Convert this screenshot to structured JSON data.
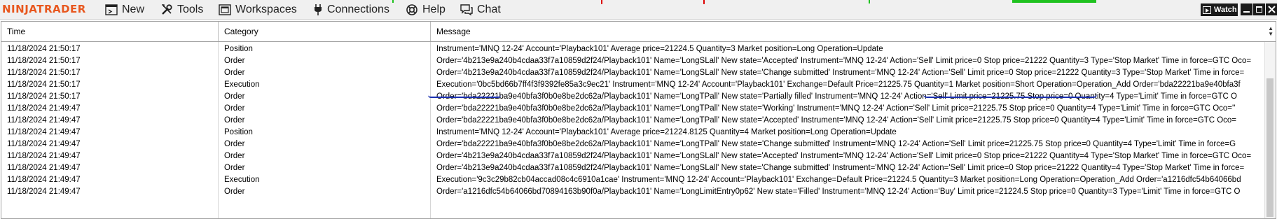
{
  "app": {
    "logo": "NINJATRADER"
  },
  "menu": {
    "items": [
      {
        "label": "New",
        "icon": "new-window-icon"
      },
      {
        "label": "Tools",
        "icon": "tools-icon"
      },
      {
        "label": "Workspaces",
        "icon": "workspaces-icon"
      },
      {
        "label": "Connections",
        "icon": "plug-icon"
      },
      {
        "label": "Help",
        "icon": "lifebuoy-icon"
      },
      {
        "label": "Chat",
        "icon": "chat-icon"
      }
    ],
    "watch_label": "Watch"
  },
  "grid": {
    "columns": [
      "Time",
      "Category",
      "Message"
    ],
    "rows": [
      {
        "time": "11/18/2024 21:50:17",
        "category": "Position",
        "message": "Instrument='MNQ 12-24' Account='Playback101' Average price=21224.5 Quantity=3 Market position=Long Operation=Update"
      },
      {
        "time": "11/18/2024 21:50:17",
        "category": "Order",
        "message": "Order='4b213e9a240b4cdaa33f7a10859d2f24/Playback101' Name='LongSLall' New state='Accepted' Instrument='MNQ 12-24' Action='Sell' Limit price=0 Stop price=21222 Quantity=3 Type='Stop Market' Time in force=GTC Oco="
      },
      {
        "time": "11/18/2024 21:50:17",
        "category": "Order",
        "message": "Order='4b213e9a240b4cdaa33f7a10859d2f24/Playback101' Name='LongSLall' New state='Change submitted' Instrument='MNQ 12-24' Action='Sell' Limit price=0 Stop price=21222 Quantity=3 Type='Stop Market' Time in force="
      },
      {
        "time": "11/18/2024 21:50:17",
        "category": "Execution",
        "message": "Execution='0bc5bd66b7ff4f3f9392fe85a3c9ec21' Instrument='MNQ 12-24' Account='Playback101' Exchange=Default Price=21225.75 Quantity=1 Market position=Short Operation=Operation_Add Order='bda22221ba9e40bfa3f"
      },
      {
        "time": "11/18/2024 21:50:17",
        "category": "Order",
        "message": "Order='bda22221ba9e40bfa3f0b0e8be2dc62a/Playback101' Name='LongTPall' New state='Partially filled' Instrument='MNQ 12-24' Action='Sell' Limit price=21225.75 Stop price=0 Quantity=4 Type='Limit' Time in force=GTC O"
      },
      {
        "time": "11/18/2024 21:49:47",
        "category": "Order",
        "message": "Order='bda22221ba9e40bfa3f0b0e8be2dc62a/Playback101' Name='LongTPall' New state='Working' Instrument='MNQ 12-24' Action='Sell' Limit price=21225.75 Stop price=0 Quantity=4 Type='Limit' Time in force=GTC Oco=''"
      },
      {
        "time": "11/18/2024 21:49:47",
        "category": "Order",
        "message": "Order='bda22221ba9e40bfa3f0b0e8be2dc62a/Playback101' Name='LongTPall' New state='Accepted' Instrument='MNQ 12-24' Action='Sell' Limit price=21225.75 Stop price=0 Quantity=4 Type='Limit' Time in force=GTC Oco="
      },
      {
        "time": "11/18/2024 21:49:47",
        "category": "Position",
        "message": "Instrument='MNQ 12-24' Account='Playback101' Average price=21224.8125 Quantity=4 Market position=Long Operation=Update"
      },
      {
        "time": "11/18/2024 21:49:47",
        "category": "Order",
        "message": "Order='bda22221ba9e40bfa3f0b0e8be2dc62a/Playback101' Name='LongTPall' New state='Change submitted' Instrument='MNQ 12-24' Action='Sell' Limit price=21225.75 Stop price=0 Quantity=4 Type='Limit' Time in force=G"
      },
      {
        "time": "11/18/2024 21:49:47",
        "category": "Order",
        "message": "Order='4b213e9a240b4cdaa33f7a10859d2f24/Playback101' Name='LongSLall' New state='Accepted' Instrument='MNQ 12-24' Action='Sell' Limit price=0 Stop price=21222 Quantity=4 Type='Stop Market' Time in force=GTC Oco="
      },
      {
        "time": "11/18/2024 21:49:47",
        "category": "Order",
        "message": "Order='4b213e9a240b4cdaa33f7a10859d2f24/Playback101' Name='LongSLall' New state='Change submitted' Instrument='MNQ 12-24' Action='Sell' Limit price=0 Stop price=21222 Quantity=4 Type='Stop Market' Time in force="
      },
      {
        "time": "11/18/2024 21:49:47",
        "category": "Execution",
        "message": "Execution='9c3c29b82cb04accad08c4c6910a1cae' Instrument='MNQ 12-24' Account='Playback101' Exchange=Default Price=21224.5 Quantity=3 Market position=Long Operation=Operation_Add Order='a1216dfc54b64066bd"
      },
      {
        "time": "11/18/2024 21:49:47",
        "category": "Order",
        "message": "Order='a1216dfc54b64066bd70894163b90f0a/Playback101' Name='LongLimitEntry0p62' New state='Filled' Instrument='MNQ 12-24' Action='Buy' Limit price=21224.5 Stop price=0 Quantity=3 Type='Limit' Time in force=GTC O"
      }
    ]
  }
}
